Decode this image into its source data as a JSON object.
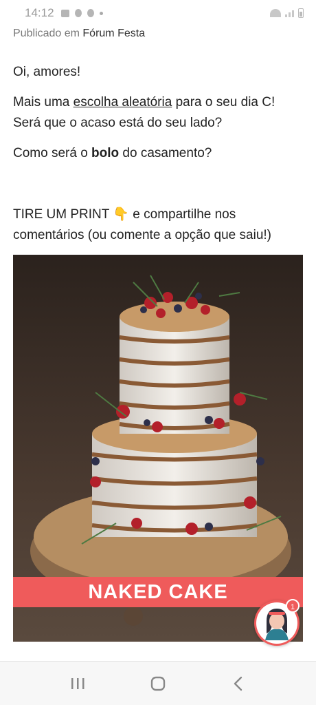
{
  "status_bar": {
    "time": "14:12"
  },
  "header": {
    "published_prefix": "Publicado em",
    "forum_name": "Fórum Festa"
  },
  "post": {
    "greeting": "Oi, amores!",
    "line1_prefix": "Mais uma ",
    "line1_link": "escolha aleatória",
    "line1_suffix": " para o seu dia C! Será que o acaso está do seu lado?",
    "line2_prefix": "Como será o ",
    "line2_bold": "bolo",
    "line2_suffix": " do casamento?",
    "line3_prefix": "TIRE UM PRINT ",
    "line3_emoji": "👇",
    "line3_suffix": " e compartilhe nos comentários (ou comente a opção que saiu!)"
  },
  "image": {
    "banner_text": "NAKED CAKE"
  },
  "chat": {
    "badge_count": "1"
  },
  "nav": {
    "recents": "recents-icon",
    "home": "home-icon",
    "back": "back-icon"
  }
}
